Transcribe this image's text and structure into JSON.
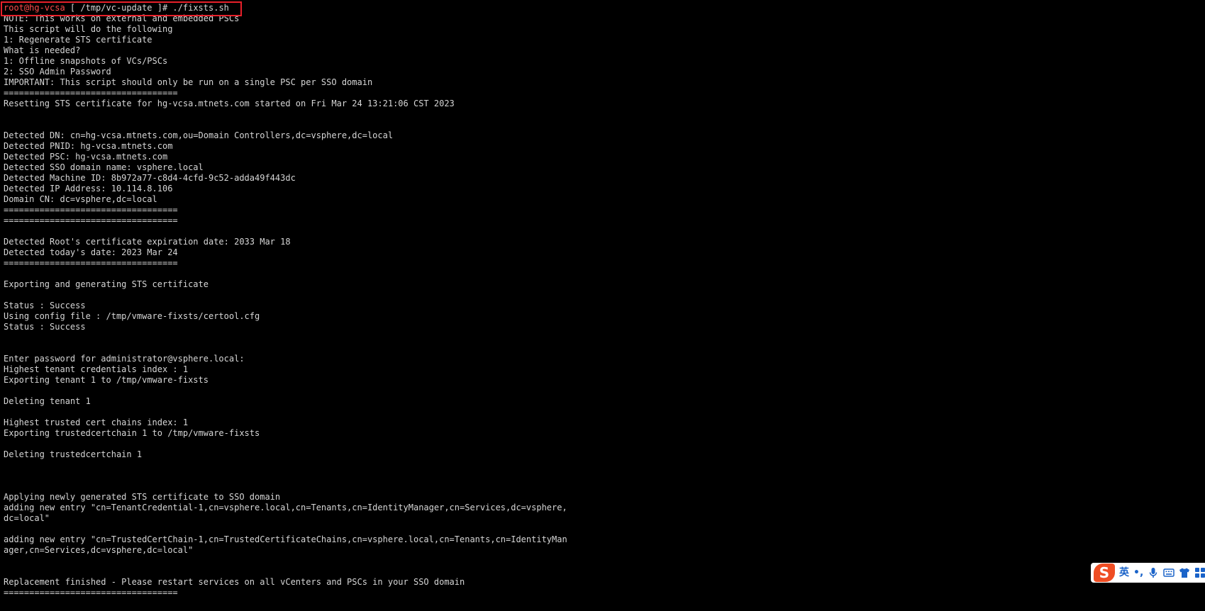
{
  "terminal": {
    "prompt_user": "root@hg-vcsa",
    "prompt_rest": " [ /tmp/vc-update ]# ./fixsts.sh",
    "lines": [
      "NOTE: This works on external and embedded PSCs",
      "This script will do the following",
      "1: Regenerate STS certificate",
      "What is needed?",
      "1: Offline snapshots of VCs/PSCs",
      "2: SSO Admin Password",
      "IMPORTANT: This script should only be run on a single PSC per SSO domain",
      "==================================",
      "Resetting STS certificate for hg-vcsa.mtnets.com started on Fri Mar 24 13:21:06 CST 2023",
      "",
      "",
      "Detected DN: cn=hg-vcsa.mtnets.com,ou=Domain Controllers,dc=vsphere,dc=local",
      "Detected PNID: hg-vcsa.mtnets.com",
      "Detected PSC: hg-vcsa.mtnets.com",
      "Detected SSO domain name: vsphere.local",
      "Detected Machine ID: 8b972a77-c8d4-4cfd-9c52-adda49f443dc",
      "Detected IP Address: 10.114.8.106",
      "Domain CN: dc=vsphere,dc=local",
      "==================================",
      "==================================",
      "",
      "Detected Root's certificate expiration date: 2033 Mar 18",
      "Detected today's date: 2023 Mar 24",
      "==================================",
      "",
      "Exporting and generating STS certificate",
      "",
      "Status : Success",
      "Using config file : /tmp/vmware-fixsts/certool.cfg",
      "Status : Success",
      "",
      "",
      "Enter password for administrator@vsphere.local:",
      "Highest tenant credentials index : 1",
      "Exporting tenant 1 to /tmp/vmware-fixsts",
      "",
      "Deleting tenant 1",
      "",
      "Highest trusted cert chains index: 1",
      "Exporting trustedcertchain 1 to /tmp/vmware-fixsts",
      "",
      "Deleting trustedcertchain 1",
      "",
      "",
      "",
      "Applying newly generated STS certificate to SSO domain",
      "adding new entry \"cn=TenantCredential-1,cn=vsphere.local,cn=Tenants,cn=IdentityManager,cn=Services,dc=vsphere,",
      "dc=local\"",
      "",
      "adding new entry \"cn=TrustedCertChain-1,cn=TrustedCertificateChains,cn=vsphere.local,cn=Tenants,cn=IdentityMan",
      "ager,cn=Services,dc=vsphere,dc=local\"",
      "",
      "",
      "Replacement finished - Please restart services on all vCenters and PSCs in your SSO domain",
      "=================================="
    ]
  },
  "ime_toolbar": {
    "logo": "S",
    "lang": "英",
    "punct": "•,",
    "icons": [
      "microphone-icon",
      "keyboard-icon",
      "shirt-icon",
      "grid-icon"
    ]
  },
  "colors": {
    "background": "#000000",
    "text": "#d6d6d6",
    "prompt_user": "#ff4b4b",
    "highlight": "#e8202a",
    "ime_brand": "#ef4d23",
    "ime_icon": "#1a63c9"
  }
}
